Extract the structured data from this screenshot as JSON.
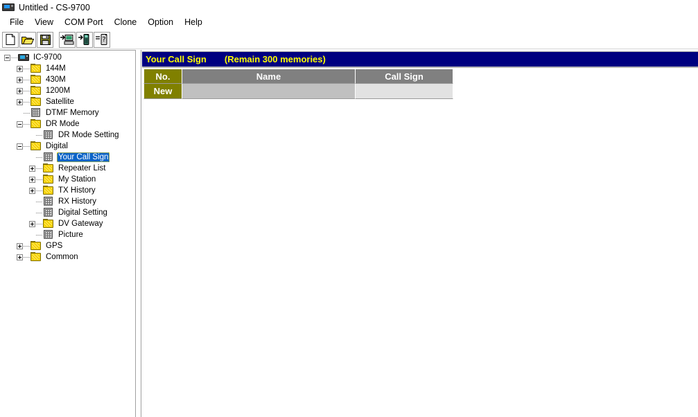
{
  "window": {
    "title": "Untitled - CS-9700",
    "icon": "radio-transceiver-icon"
  },
  "menubar": {
    "items": [
      {
        "label": "File"
      },
      {
        "label": "View"
      },
      {
        "label": "COM Port"
      },
      {
        "label": "Clone"
      },
      {
        "label": "Option"
      },
      {
        "label": "Help"
      }
    ]
  },
  "toolbar": {
    "buttons": [
      {
        "name": "new-file-icon",
        "tooltip": "New"
      },
      {
        "name": "open-folder-icon",
        "tooltip": "Open"
      },
      {
        "name": "save-disk-icon",
        "tooltip": "Save"
      },
      {
        "name": "read-from-radio-to-pc-icon",
        "tooltip": "Clone Read"
      },
      {
        "name": "write-to-radio-icon",
        "tooltip": "Clone Write"
      },
      {
        "name": "radio-info-icon",
        "tooltip": "Radio Information"
      }
    ]
  },
  "tree": {
    "root": {
      "label": "IC-9700",
      "icon": "radio-icon",
      "expanded": true
    },
    "items": [
      {
        "label": "144M",
        "icon": "folder-icon",
        "depth": 1,
        "toggle": "plus"
      },
      {
        "label": "430M",
        "icon": "folder-icon",
        "depth": 1,
        "toggle": "plus"
      },
      {
        "label": "1200M",
        "icon": "folder-icon",
        "depth": 1,
        "toggle": "plus"
      },
      {
        "label": "Satellite",
        "icon": "folder-icon",
        "depth": 1,
        "toggle": "plus"
      },
      {
        "label": "DTMF Memory",
        "icon": "document-icon",
        "depth": 1,
        "toggle": "none"
      },
      {
        "label": "DR Mode",
        "icon": "folder-icon",
        "depth": 1,
        "toggle": "minus"
      },
      {
        "label": "DR Mode Setting",
        "icon": "document-icon",
        "depth": 2,
        "toggle": "none"
      },
      {
        "label": "Digital",
        "icon": "folder-icon",
        "depth": 1,
        "toggle": "minus"
      },
      {
        "label": "Your Call Sign",
        "icon": "document-icon",
        "depth": 2,
        "toggle": "none",
        "selected": true
      },
      {
        "label": "Repeater List",
        "icon": "folder-icon",
        "depth": 2,
        "toggle": "plus"
      },
      {
        "label": "My Station",
        "icon": "folder-icon",
        "depth": 2,
        "toggle": "plus"
      },
      {
        "label": "TX History",
        "icon": "folder-icon",
        "depth": 2,
        "toggle": "plus"
      },
      {
        "label": "RX History",
        "icon": "document-icon",
        "depth": 2,
        "toggle": "none"
      },
      {
        "label": "Digital Setting",
        "icon": "document-icon",
        "depth": 2,
        "toggle": "none"
      },
      {
        "label": "DV Gateway",
        "icon": "folder-icon",
        "depth": 2,
        "toggle": "plus"
      },
      {
        "label": "Picture",
        "icon": "document-icon",
        "depth": 2,
        "toggle": "none"
      },
      {
        "label": "GPS",
        "icon": "folder-icon",
        "depth": 1,
        "toggle": "plus"
      },
      {
        "label": "Common",
        "icon": "folder-icon",
        "depth": 1,
        "toggle": "plus"
      }
    ]
  },
  "panel": {
    "title": "Your Call Sign",
    "remain": "(Remain 300 memories)",
    "header_bg": "#000080",
    "header_fg": "#ffff00"
  },
  "table": {
    "columns": [
      {
        "label": "No.",
        "accent": "#808000"
      },
      {
        "label": "Name",
        "accent": "#808080"
      },
      {
        "label": "Call Sign",
        "accent": "#808080"
      }
    ],
    "rows": [
      {
        "no": "New",
        "name": "",
        "call_sign": ""
      }
    ]
  }
}
